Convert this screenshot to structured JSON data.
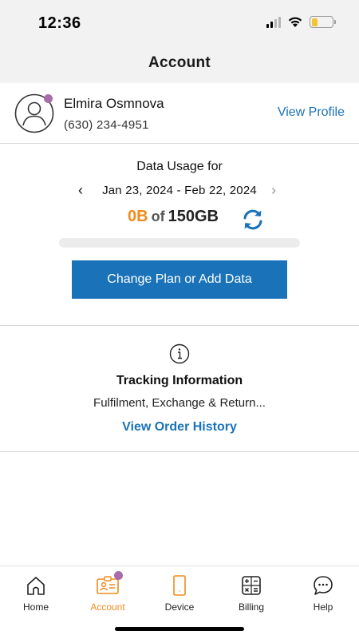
{
  "status_bar": {
    "time": "12:36"
  },
  "header": {
    "title": "Account"
  },
  "profile": {
    "name": "Elmira Osmnova",
    "phone": "(630) 234-4951",
    "view_profile_label": "View Profile"
  },
  "usage": {
    "title": "Data Usage for",
    "period": "Jan 23, 2024 - Feb 22, 2024",
    "used": "0B",
    "of_label": "of",
    "total": "150GB",
    "used_fraction": 0,
    "cta_label": "Change Plan or Add Data"
  },
  "tracking": {
    "title": "Tracking Information",
    "subtitle": "Fulfilment, Exchange & Return...",
    "link_label": "View Order History"
  },
  "tabs": [
    {
      "label": "Home",
      "icon": "home-icon"
    },
    {
      "label": "Account",
      "icon": "account-card-icon",
      "active": true
    },
    {
      "label": "Device",
      "icon": "device-icon"
    },
    {
      "label": "Billing",
      "icon": "calculator-icon"
    },
    {
      "label": "Help",
      "icon": "chat-bubble-icon"
    }
  ],
  "colors": {
    "accent_blue": "#1a72b8",
    "accent_orange": "#ef8c1c",
    "notification_purple": "#a86ca8"
  }
}
